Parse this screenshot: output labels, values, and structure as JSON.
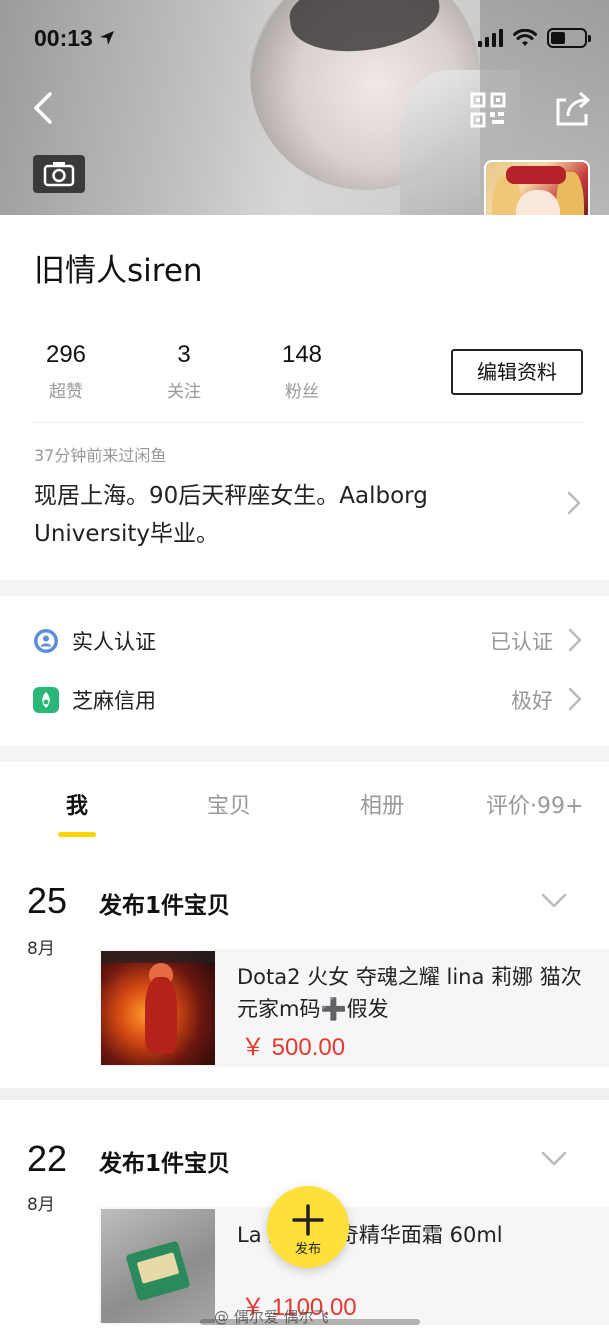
{
  "status_bar": {
    "time": "00:13"
  },
  "profile": {
    "name": "旧情人siren",
    "stats": [
      {
        "value": "296",
        "label": "超赞"
      },
      {
        "value": "3",
        "label": "关注"
      },
      {
        "value": "148",
        "label": "粉丝"
      }
    ],
    "edit_label": "编辑资料",
    "last_seen": "37分钟前来过闲鱼",
    "bio": "现居上海。90后天秤座女生。Aalborg University毕业。"
  },
  "verification": [
    {
      "label": "实人认证",
      "status": "已认证",
      "icon": "person-verify-icon"
    },
    {
      "label": "芝麻信用",
      "status": "极好",
      "icon": "sesame-credit-icon"
    }
  ],
  "tabs": [
    {
      "label": "我",
      "active": true
    },
    {
      "label": "宝贝",
      "active": false
    },
    {
      "label": "相册",
      "active": false
    },
    {
      "label": "评价·99+",
      "active": false
    }
  ],
  "feed": [
    {
      "day": "25",
      "month": "8月",
      "title": "发布1件宝贝",
      "item": {
        "text": "Dota2 火女 夺魂之耀 lina 莉娜 猫次元家m码➕假发",
        "price": "￥ 500.00"
      }
    },
    {
      "day": "22",
      "month": "8月",
      "title": "发布1件宝贝",
      "item": {
        "text": "La 之谜 神奇精华面霜 60ml",
        "price": "￥ 1100.00"
      }
    }
  ],
  "fab": {
    "label": "发布"
  },
  "watermark": "@ 偶尔爱  偶尔飞",
  "colors": {
    "accent": "#ffd400",
    "price": "#e43a2f"
  }
}
